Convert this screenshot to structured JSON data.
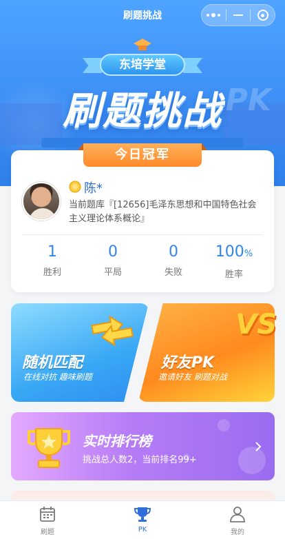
{
  "nav": {
    "title": "刷题挑战"
  },
  "hero": {
    "school": "东培学堂",
    "title": "刷题挑战",
    "pk_watermark": "PK"
  },
  "champion": {
    "tab_label": "今日冠军",
    "name": "陈*",
    "bank_text": "当前题库『[12656]毛泽东思想和中国特色社会主义理论体系概论』",
    "stats": [
      {
        "value": "1",
        "label": "胜利"
      },
      {
        "value": "0",
        "label": "平局"
      },
      {
        "value": "0",
        "label": "失败"
      },
      {
        "value": "100",
        "unit": "%",
        "label": "胜率"
      }
    ]
  },
  "modes": {
    "random": {
      "title": "随机匹配",
      "subtitle": "在线对抗 趣味刷题"
    },
    "friend": {
      "title": "好友PK",
      "subtitle": "邀请好友 刷题对战",
      "badge": "VS"
    }
  },
  "ranking": {
    "title": "实时排行榜",
    "subtitle": "挑战总人数2，当前排名99+"
  },
  "tabbar": [
    {
      "label": "刷题",
      "icon": "calendar-icon",
      "active": false
    },
    {
      "label": "PK",
      "icon": "trophy-icon",
      "active": true
    },
    {
      "label": "我的",
      "icon": "person-icon",
      "active": false
    }
  ],
  "colors": {
    "primary": "#2f86e8",
    "champion_tab": "#ff8a2a",
    "random_bg": "#3aa8f5",
    "friend_bg": "#ff8a1e",
    "ranking_bg": "#b67cf6"
  }
}
